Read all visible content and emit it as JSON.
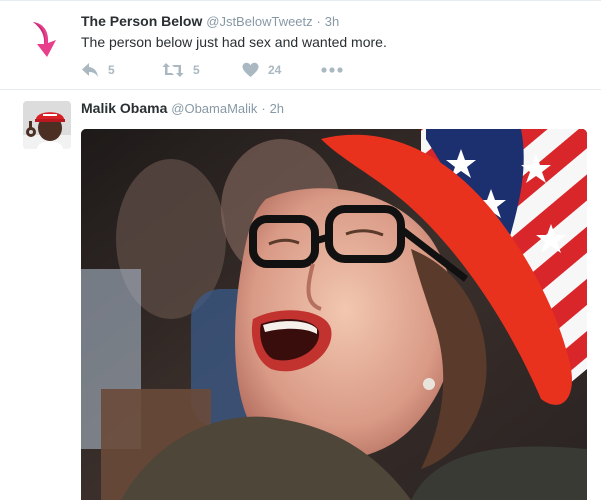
{
  "tweets": [
    {
      "author": {
        "fullname": "The Person Below",
        "username": "@JstBelowTweetz",
        "avatar_icon": "pink-down-arrow-icon"
      },
      "separator": "·",
      "time": "3h",
      "text": "The person below just had sex and wanted more.",
      "actions": {
        "reply_count": "5",
        "retweet_count": "5",
        "like_count": "24"
      }
    },
    {
      "author": {
        "fullname": "Malik Obama",
        "username": "@ObamaMalik",
        "avatar_icon": "profile-photo"
      },
      "separator": "·",
      "time": "2h",
      "media": "photo"
    }
  ],
  "colors": {
    "text_primary": "#292f33",
    "text_secondary": "#8899a6",
    "action_icon": "#aab8c2",
    "divider": "#e6ecf0",
    "avatar_arrow": "#e83e8c",
    "hat_red": "#e8321e"
  }
}
